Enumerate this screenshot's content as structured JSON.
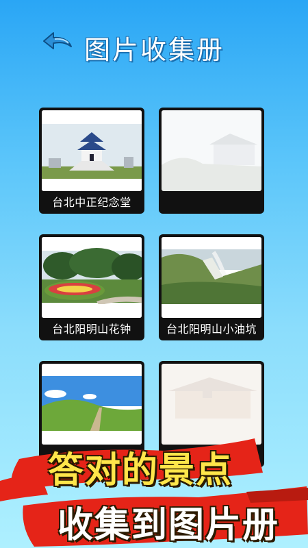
{
  "header": {
    "title": "图片收集册",
    "back_icon": "back-arrow-icon"
  },
  "cards": [
    {
      "caption": "台北中正纪念堂",
      "locked": false
    },
    {
      "caption": "",
      "locked": true
    },
    {
      "caption": "台北阳明山花钟",
      "locked": false
    },
    {
      "caption": "台北阳明山小油坑",
      "locked": false
    },
    {
      "caption": "",
      "locked": false
    },
    {
      "caption": "",
      "locked": true
    }
  ],
  "banner": {
    "line1": "答对的景点",
    "line2": "收集到图片册"
  },
  "colors": {
    "accent": "#ffe64a",
    "banner_red": "#e52418",
    "card_bg": "#111111"
  }
}
